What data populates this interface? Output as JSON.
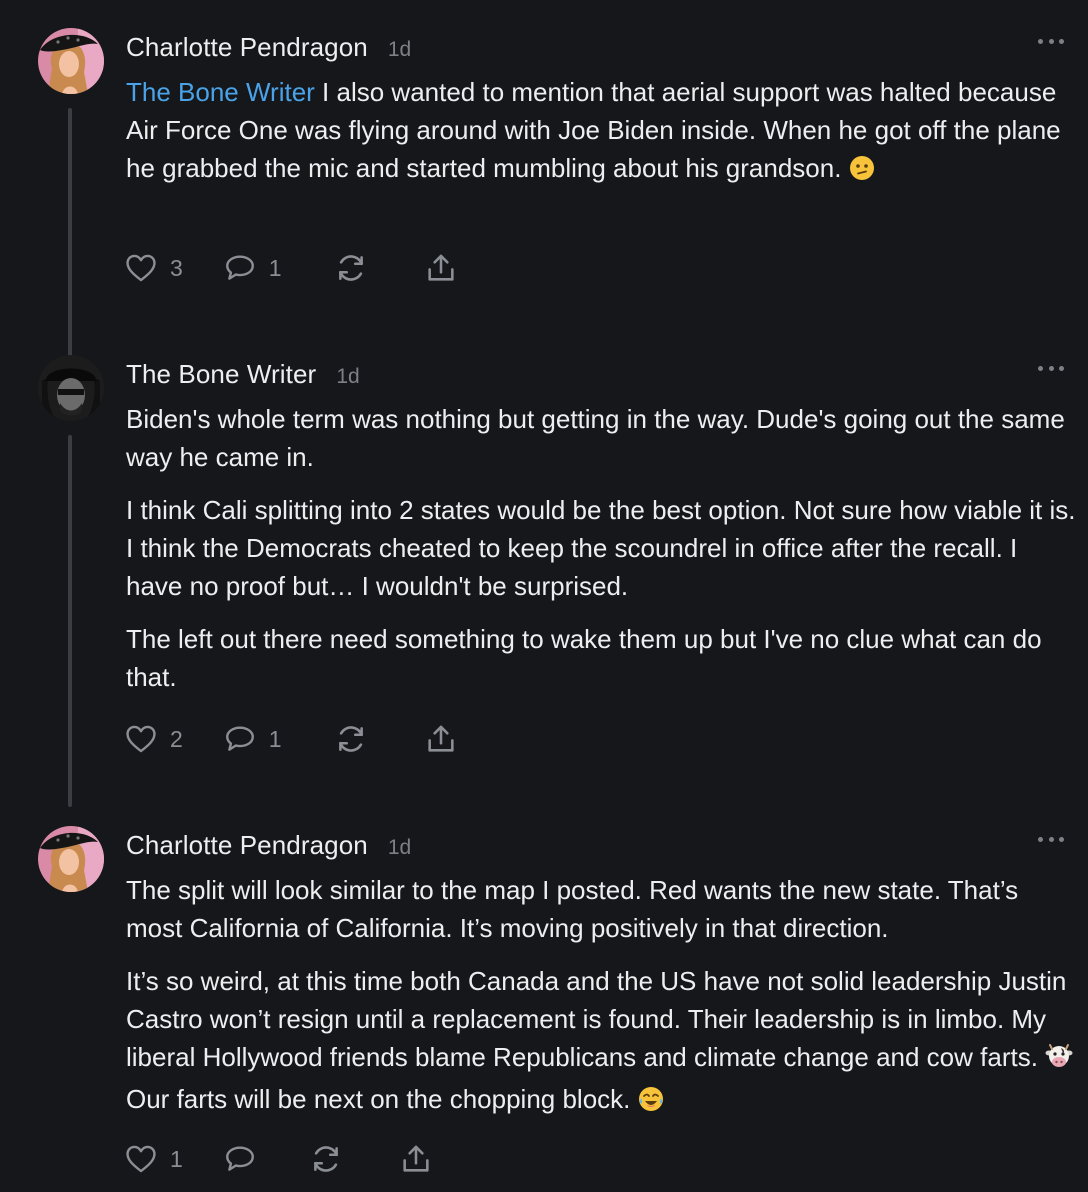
{
  "comments": [
    {
      "author": "Charlotte Pendragon",
      "time": "1d",
      "mention": "The Bone Writer",
      "paragraphs": [
        " I also wanted to mention that aerial support was halted because Air Force One was flying around with Joe Biden inside. When he got off the plane he grabbed the mic and started mumbling about his grandson. "
      ],
      "emoji": "confused-face",
      "likes": "3",
      "replies": "1"
    },
    {
      "author": "The Bone Writer",
      "time": "1d",
      "paragraphs": [
        "Biden's whole term was nothing but getting in the way. Dude's going out the same way he came in.",
        "I think Cali splitting into 2 states would be the best option. Not sure how viable it is. I think the Democrats cheated to keep the scoundrel in office after the recall. I have no proof but… I wouldn't be surprised.",
        "The left out there need something to wake them up but I've no clue what can do that."
      ],
      "likes": "2",
      "replies": "1"
    },
    {
      "author": "Charlotte Pendragon",
      "time": "1d",
      "paragraphs": [
        "The split will look similar to the map I posted. Red wants the new state. That’s most California of California. It’s moving positively in that direction.",
        "It’s so weird, at this time both Canada and the US have not solid leadership Justin Castro won’t resign until a replacement is found. Their leadership is in limbo. My liberal Hollywood friends blame Republicans and climate change and cow farts.",
        " Our farts will be next on the chopping block. "
      ],
      "emoji_cow": "cow-face",
      "emoji_laugh": "tears-of-joy-face",
      "likes": "1",
      "replies": ""
    }
  ],
  "icons": {
    "like": "heart-icon",
    "reply": "speech-bubble-icon",
    "restack": "restack-icon",
    "share": "share-icon",
    "more": "ellipsis-icon"
  },
  "colors": {
    "background": "#15171a",
    "text": "#eceef0",
    "muted": "#7d8187",
    "mention": "#4aa3e8",
    "thread_line": "#3a3d42"
  }
}
